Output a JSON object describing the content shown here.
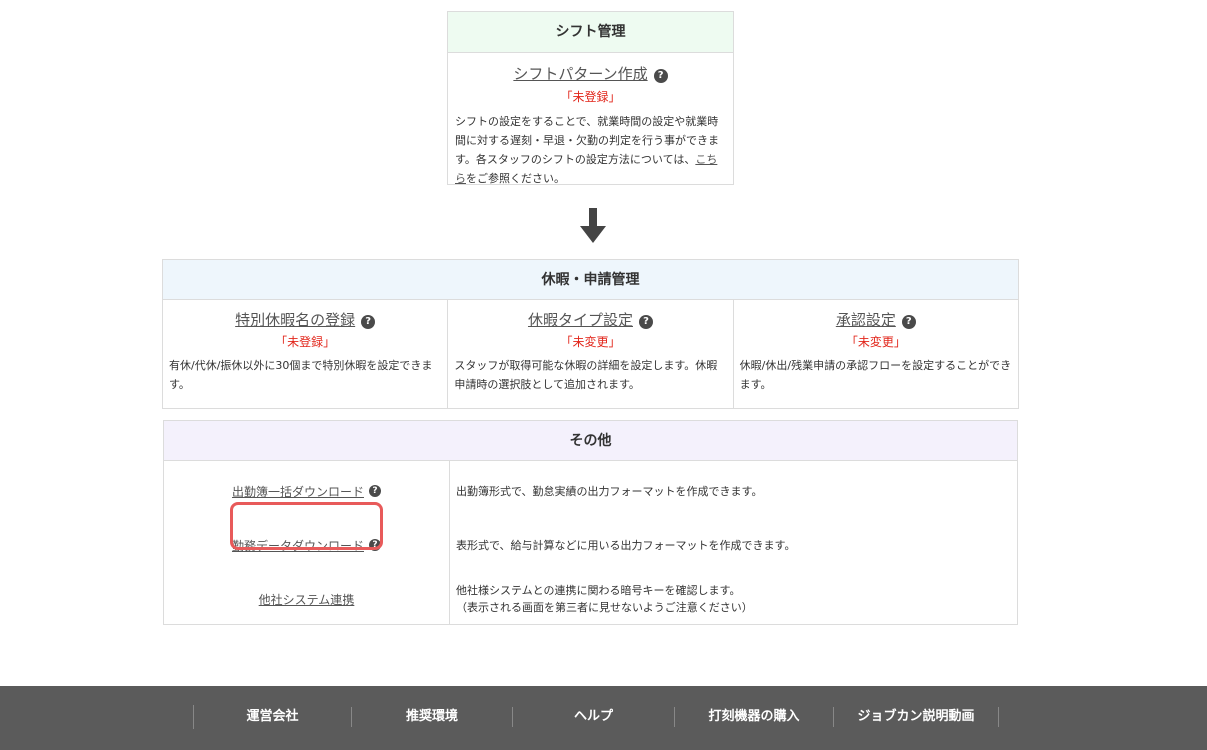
{
  "shift": {
    "header": "シフト管理",
    "title": "シフトパターン作成",
    "status": "「未登録」",
    "desc_before_link": "シフトの設定をすることで、就業時間の設定や就業時間に対する遅刻・早退・欠勤の判定を行う事ができます。各スタッフのシフトの設定方法については、",
    "desc_link": "こちら",
    "desc_after_link": "をご参照ください。"
  },
  "leave": {
    "header": "休暇・申請管理",
    "items": [
      {
        "title": "特別休暇名の登録",
        "status": "「未登録」",
        "desc": "有休/代休/振休以外に30個まで特別休暇を設定できます。"
      },
      {
        "title": "休暇タイプ設定",
        "status": "「未変更」",
        "desc": "スタッフが取得可能な休暇の詳細を設定します。休暇申請時の選択肢として追加されます。"
      },
      {
        "title": "承認設定",
        "status": "「未変更」",
        "desc": "休暇/休出/残業申請の承認フローを設定することができます。"
      }
    ]
  },
  "other": {
    "header": "その他",
    "rows": [
      {
        "link": "出勤簿一括ダウンロード",
        "desc_line1": "出勤簿形式で、勤怠実績の出力フォーマットを作成できます。",
        "desc_line2": ""
      },
      {
        "link": "勤務データダウンロード",
        "desc_line1": "表形式で、給与計算などに用いる出力フォーマットを作成できます。",
        "desc_line2": ""
      },
      {
        "link": "他社システム連携",
        "desc_line1": "他社様システムとの連携に関わる暗号キーを確認します。",
        "desc_line2": "（表示される画面を第三者に見せないようご注意ください）"
      }
    ]
  },
  "help_icon_glyph": "?",
  "footer": {
    "items": [
      "運営会社",
      "推奨環境",
      "ヘルプ",
      "打刻機器の購入",
      "ジョブカン説明動画"
    ]
  },
  "colors": {
    "shift_header_bg": "#eefbf1",
    "leave_header_bg": "#eef6fc",
    "other_header_bg": "#f4f1fc",
    "status_red": "#e2261b",
    "highlight": "#e85a5a",
    "footer_bg": "#5b5b5b"
  }
}
